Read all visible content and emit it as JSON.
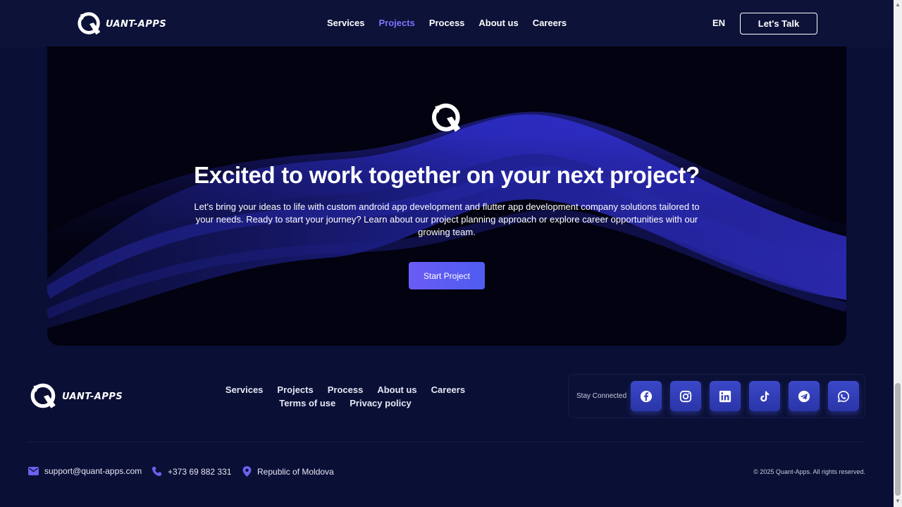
{
  "header": {
    "brand": "UANT-APPS",
    "nav": [
      "Services",
      "Projects",
      "Process",
      "About us",
      "Careers"
    ],
    "active_nav": "Projects",
    "language": "EN",
    "cta_label": "Let's Talk"
  },
  "hero": {
    "title": "Excited to work together on your next project?",
    "description": "Let's bring your ideas to life with custom android app development and flutter app development company solutions tailored to your needs. Ready to start your journey? Learn about our project planning approach or explore career opportunities with our growing team.",
    "button_label": "Start Project"
  },
  "footer": {
    "brand": "UANT-APPS",
    "links_row1": [
      "Services",
      "Projects",
      "Process",
      "About us",
      "Careers"
    ],
    "links_row2": [
      "Terms of use",
      "Privacy policy"
    ],
    "social_label": "Stay Connected",
    "social_icons": [
      "facebook-icon",
      "instagram-icon",
      "linkedin-icon",
      "tiktok-icon",
      "telegram-icon",
      "whatsapp-icon"
    ],
    "email": "support@quant-apps.com",
    "phone": "+373 69 882 331",
    "location": "Republic of Moldova",
    "copyright": "© 2025 Quant-Apps. All rights reserved."
  },
  "colors": {
    "background": "#0a0f35",
    "accent": "#7b74ff",
    "button_gradient_start": "#6a5cf5",
    "social_button": "#3b48c8"
  }
}
